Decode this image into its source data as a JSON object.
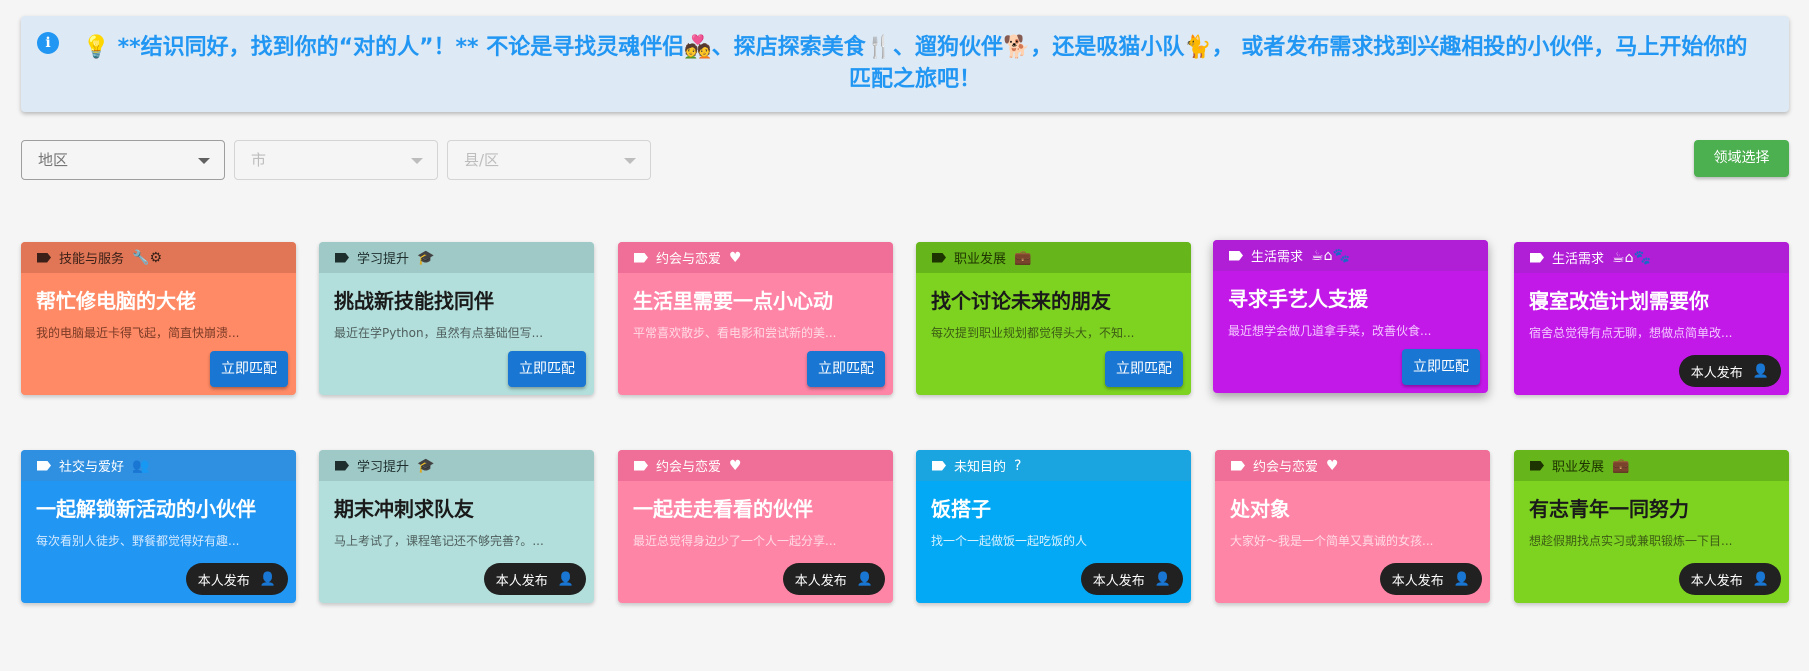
{
  "banner": {
    "info_icon": "info-icon",
    "text": "💡 **结识同好，找到你的“对的人”！** 不论是寻找灵魂伴侣💑、探店探索美食🍴、遛狗伙伴🐕，还是吸猫小队🐈， 或者发布需求找到兴趣相投的小伙伴，马上开始你的匹配之旅吧！"
  },
  "filters": {
    "region": "地区",
    "city": "市",
    "county": "县/区",
    "domain_button": "领域选择"
  },
  "labels": {
    "match": "立即匹配",
    "self_post": "本人发布"
  },
  "cards": [
    {
      "category": "技能与服务",
      "icon": "🔧⚙",
      "title": "帮忙修电脑的大佬",
      "desc": "我的电脑最近卡得飞起，简直快崩溃...",
      "action": "match"
    },
    {
      "category": "学习提升",
      "icon": "🎓",
      "title": "挑战新技能找同伴",
      "desc": "最近在学Python，虽然有点基础但写...",
      "action": "match"
    },
    {
      "category": "约会与恋爱",
      "icon": "♥",
      "title": "生活里需要一点小心动",
      "desc": "平常喜欢散步、看电影和尝试新的美...",
      "action": "match"
    },
    {
      "category": "职业发展",
      "icon": "💼",
      "title": "找个讨论未来的朋友",
      "desc": "每次提到职业规划都觉得头大，不知...",
      "action": "match"
    },
    {
      "category": "生活需求",
      "icon": "☕⌂🐾",
      "title": "寻求手艺人支援",
      "desc": "最近想学会做几道拿手菜，改善伙食...",
      "action": "match"
    },
    {
      "category": "生活需求",
      "icon": "☕⌂🐾",
      "title": "寝室改造计划需要你",
      "desc": "宿舍总觉得有点无聊，想做点简单改...",
      "action": "self"
    },
    {
      "category": "社交与爱好",
      "icon": "👥",
      "title": "一起解锁新活动的小伙伴",
      "desc": "每次看别人徒步、野餐都觉得好有趣...",
      "action": "self"
    },
    {
      "category": "学习提升",
      "icon": "🎓",
      "title": "期末冲刺求队友",
      "desc": "马上考试了，课程笔记还不够完善?。...",
      "action": "self"
    },
    {
      "category": "约会与恋爱",
      "icon": "♥",
      "title": "一起走走看看的伙伴",
      "desc": "最近总觉得身边少了一个人一起分享...",
      "action": "self"
    },
    {
      "category": "未知目的",
      "icon": "?",
      "title": "饭搭子",
      "desc": "找一个一起做饭一起吃饭的人",
      "action": "self"
    },
    {
      "category": "约会与恋爱",
      "icon": "♥",
      "title": "处对象",
      "desc": "大家好～我是一个简单又真诚的女孩...",
      "action": "self"
    },
    {
      "category": "职业发展",
      "icon": "💼",
      "title": "有志青年一同努力",
      "desc": "想趁假期找点实习或兼职锻炼一下目...",
      "action": "self"
    }
  ]
}
